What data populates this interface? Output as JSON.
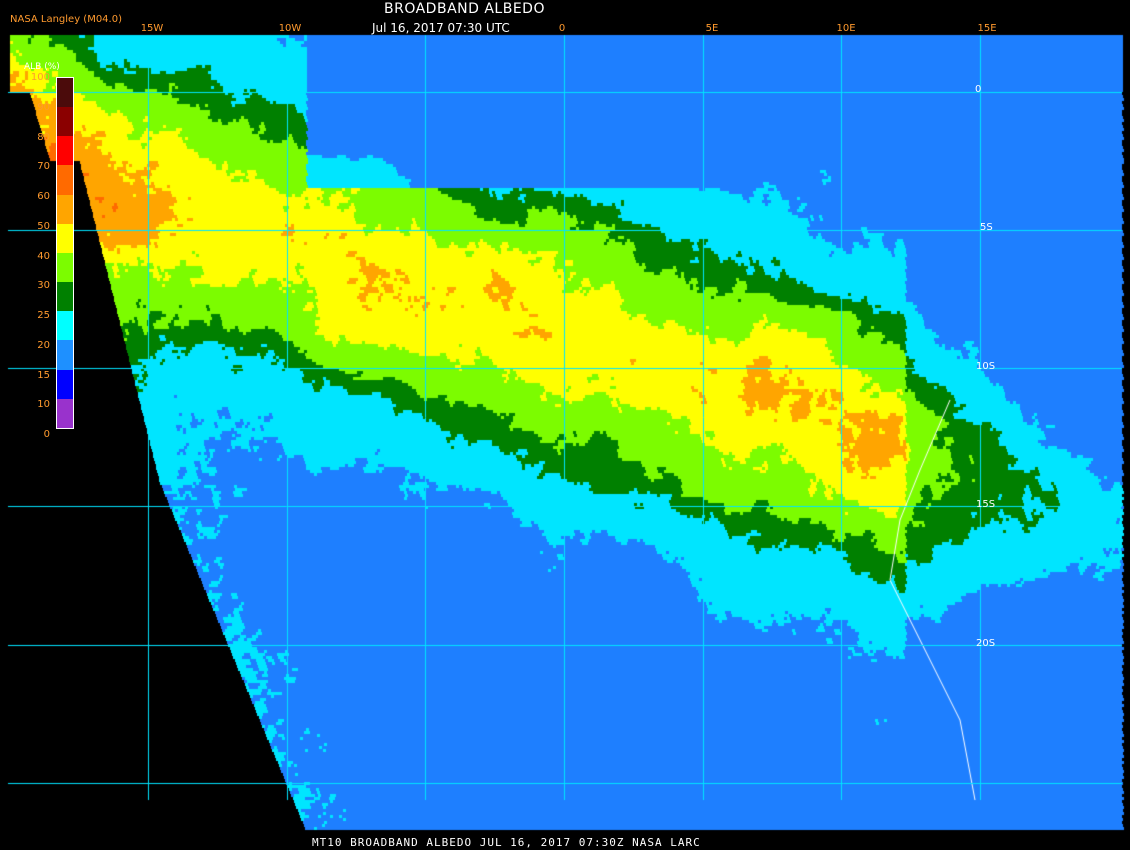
{
  "header": {
    "title": "BROADBAND ALBEDO",
    "subtitle": "Jul 16, 2017 07:30 UTC",
    "brand": "NASA Langley (M04.0)"
  },
  "footer": {
    "text": "MT10  BROADBAND ALBEDO   JUL 16, 2017 07:30Z   NASA LARC"
  },
  "grid": {
    "longitudes": [
      "15W",
      "10W",
      "0",
      "5E",
      "10E",
      "15E"
    ],
    "latitudes": [
      "0",
      "5S",
      "10S",
      "15S",
      "20S"
    ],
    "color": "#00e5ff"
  },
  "legend": {
    "title": "ALB (%)",
    "ticks": [
      "100",
      "90",
      "80",
      "70",
      "60",
      "50",
      "40",
      "30",
      "25",
      "20",
      "15",
      "10",
      "0"
    ],
    "colors": [
      "#4b0b0b",
      "#8b0000",
      "#ff0000",
      "#ff6a00",
      "#ffa500",
      "#ffff00",
      "#7cfc00",
      "#008000",
      "#00ffff",
      "#1e90ff",
      "#0000ff",
      "#9932cc"
    ]
  },
  "palette": {
    "ocean_clear": "#00e5ff",
    "ocean_deep": "#1e7fff",
    "cloud_thin": "#7cfc00",
    "cloud_mid": "#ffff00",
    "cloud_orange": "#ff6a00",
    "cloud_bright": "#ff0000",
    "cloud_brightest": "#7a0000",
    "land_veg": "#008000",
    "background": "#000000"
  }
}
